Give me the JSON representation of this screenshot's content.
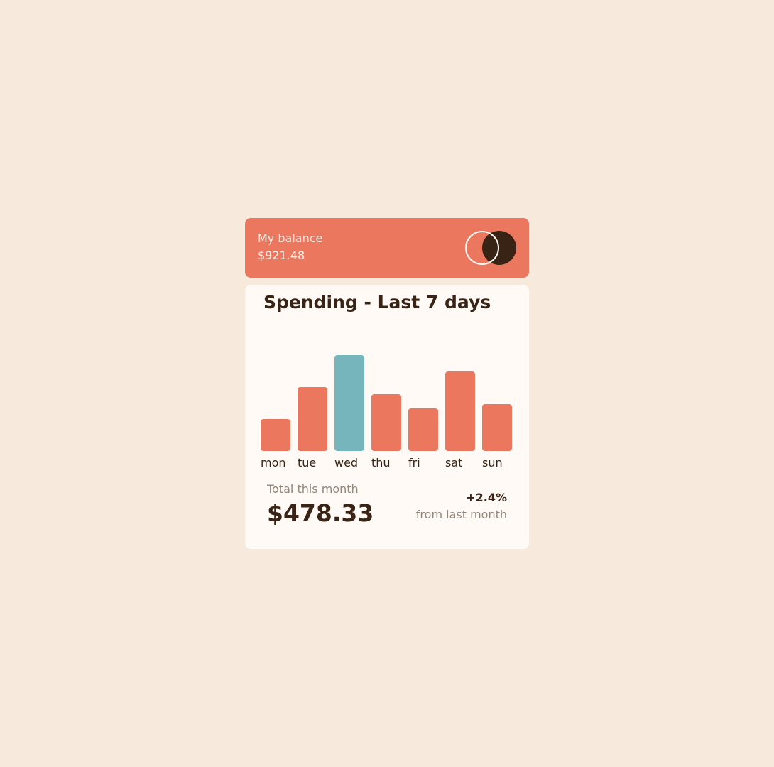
{
  "balance": {
    "label": "My balance",
    "amount": "$921.48"
  },
  "logo": {
    "icon": "two-circles-logo-icon",
    "ring_color": "#fffaf5",
    "fill_color": "#382314"
  },
  "spending": {
    "title": "Spending - Last 7 days",
    "total_label": "Total this month",
    "total_amount": "$478.33",
    "change_percent": "+2.4%",
    "change_label": "from last month"
  },
  "colors": {
    "accent": "#ec775f",
    "highlight": "#76b5bc",
    "dark": "#382314",
    "muted": "#93867b",
    "background": "#f7e9dc",
    "card": "#fffaf5"
  },
  "chart_data": {
    "type": "bar",
    "categories": [
      "mon",
      "tue",
      "wed",
      "thu",
      "fri",
      "sat",
      "sun"
    ],
    "values": [
      17.45,
      34.91,
      52.36,
      31.07,
      23.39,
      43.28,
      25.48
    ],
    "highlight_index": 2,
    "ylim": [
      0,
      52.36
    ]
  }
}
